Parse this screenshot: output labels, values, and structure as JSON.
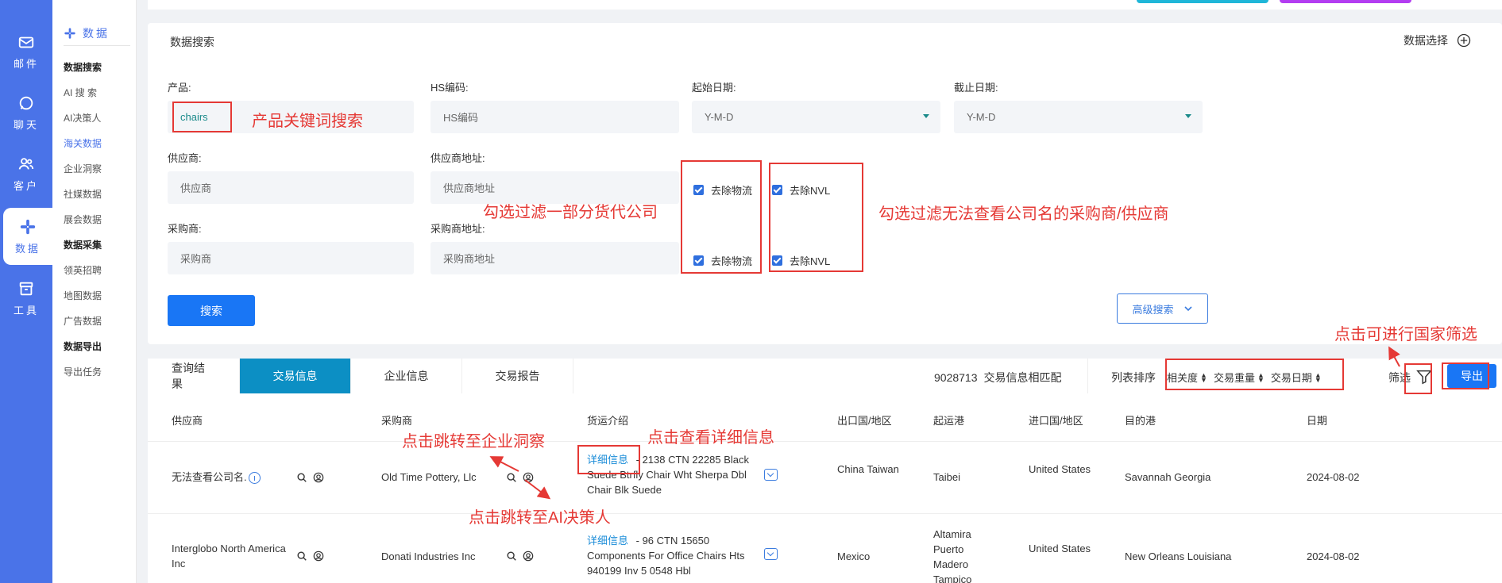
{
  "rail": [
    {
      "label": "邮件",
      "icon": "mail-icon"
    },
    {
      "label": "聊天",
      "icon": "whatsapp-icon"
    },
    {
      "label": "客户",
      "icon": "users-icon"
    },
    {
      "label": "数据",
      "icon": "slack-icon"
    },
    {
      "label": "工具",
      "icon": "archive-icon"
    }
  ],
  "subnav": {
    "header": "数据",
    "items": [
      "数据搜索",
      "AI 搜 索",
      "AI决策人",
      "海关数据",
      "企业洞察",
      "社媒数据",
      "展会数据",
      "数据采集",
      "领英招聘",
      "地图数据",
      "广告数据",
      "数据导出",
      "导出任务"
    ]
  },
  "search": {
    "title": "数据搜索",
    "data_select": "数据选择",
    "product_label": "产品:",
    "product_value": "chairs",
    "hs_label": "HS编码:",
    "hs_placeholder": "HS编码",
    "start_label": "起始日期:",
    "start_value": "Y-M-D",
    "end_label": "截止日期:",
    "end_value": "Y-M-D",
    "supplier_label": "供应商:",
    "supplier_placeholder": "供应商",
    "supplier_addr_label": "供应商地址:",
    "supplier_addr_placeholder": "供应商地址",
    "buyer_label": "采购商:",
    "buyer_placeholder": "采购商",
    "buyer_addr_label": "采购商地址:",
    "buyer_addr_placeholder": "采购商地址",
    "remove_logistics": "去除物流",
    "remove_nvl": "去除NVL",
    "search_button": "搜索",
    "advanced_button": "高级搜索"
  },
  "results": {
    "tabs": [
      "查询结果",
      "交易信息",
      "企业信息",
      "交易报告"
    ],
    "match_count": "9028713",
    "match_text": "交易信息相匹配",
    "sort_label": "列表排序",
    "sort_options": [
      "相关度",
      "交易重量",
      "交易日期"
    ],
    "filter_label": "筛选",
    "export_button": "导出",
    "columns": [
      "供应商",
      "采购商",
      "货运介绍",
      "出口国/地区",
      "起运港",
      "进口国/地区",
      "目的港",
      "日期"
    ],
    "rows": [
      {
        "supplier": "无法查看公司名.",
        "buyer": "Old Time Pottery, Llc",
        "detail": "详细信息",
        "cargo": " - 2138 CTN 22285 Black Suede Btrfly Chair Wht Sherpa Dbl Chair Blk Suede",
        "export_country": "China Taiwan",
        "origin_port": "Taibei",
        "import_country": "United States",
        "dest_port": "Savannah Georgia",
        "date": "2024-08-02"
      },
      {
        "supplier": "Interglobo North America Inc",
        "buyer": "Donati Industries Inc",
        "detail": "详细信息",
        "cargo": " - 96 CTN 15650 Components For Office Chairs Hts 940199 Inv 5 0548 Hbl",
        "export_country": "Mexico",
        "origin_port": "Altamira Puerto Madero Tampico",
        "import_country": "United States",
        "dest_port": "New Orleans Louisiana",
        "date": "2024-08-02"
      }
    ]
  },
  "annotations": {
    "product_keyword": "产品关键词搜索",
    "filter_forwarders": "勾选过滤一部分货代公司",
    "filter_nvl": "勾选过滤无法查看公司名的采购商/供应商",
    "country_filter": "点击可进行国家筛选",
    "jump_enterprise": "点击跳转至企业洞察",
    "view_detail": "点击查看详细信息",
    "jump_ai": "点击跳转至AI决策人"
  },
  "colors": {
    "rail": "#4a73e8",
    "primary": "#1976f5",
    "active_tab": "#0c8fc4",
    "annotation": "#e53935"
  }
}
